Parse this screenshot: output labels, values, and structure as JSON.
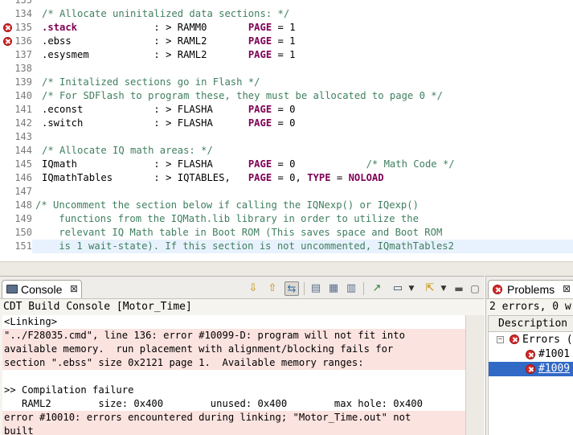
{
  "editor": {
    "lines": [
      {
        "num": "135",
        "tokens": []
      },
      {
        "num": "134",
        "tokens": [
          {
            "c": "cm",
            "t": "/* Allocate uninitalized data sections: */"
          }
        ]
      },
      {
        "num": "135",
        "error": true,
        "tokens": [
          {
            "c": "kw",
            "t": ".stack"
          },
          {
            "c": "",
            "t": "             : > RAMM0       "
          },
          {
            "c": "kw",
            "t": "PAGE"
          },
          {
            "c": "",
            "t": " = 1"
          }
        ]
      },
      {
        "num": "136",
        "error": true,
        "tokens": [
          {
            "c": "",
            "t": ".ebss              : > RAML2       "
          },
          {
            "c": "kw",
            "t": "PAGE"
          },
          {
            "c": "",
            "t": " = 1"
          }
        ]
      },
      {
        "num": "137",
        "tokens": [
          {
            "c": "",
            "t": ".esysmem           : > RAML2       "
          },
          {
            "c": "kw",
            "t": "PAGE"
          },
          {
            "c": "",
            "t": " = 1"
          }
        ]
      },
      {
        "num": "138",
        "tokens": []
      },
      {
        "num": "139",
        "tokens": [
          {
            "c": "cm",
            "t": "/* Initalized sections go in Flash */"
          }
        ]
      },
      {
        "num": "140",
        "tokens": [
          {
            "c": "cm",
            "t": "/* For SDFlash to program these, they must be allocated to page 0 */"
          }
        ]
      },
      {
        "num": "141",
        "tokens": [
          {
            "c": "",
            "t": ".econst            : > FLASHA      "
          },
          {
            "c": "kw",
            "t": "PAGE"
          },
          {
            "c": "",
            "t": " = 0"
          }
        ]
      },
      {
        "num": "142",
        "tokens": [
          {
            "c": "",
            "t": ".switch            : > FLASHA      "
          },
          {
            "c": "kw",
            "t": "PAGE"
          },
          {
            "c": "",
            "t": " = 0"
          }
        ]
      },
      {
        "num": "143",
        "tokens": []
      },
      {
        "num": "144",
        "tokens": [
          {
            "c": "cm",
            "t": "/* Allocate IQ math areas: */"
          }
        ]
      },
      {
        "num": "145",
        "tokens": [
          {
            "c": "",
            "t": "IQmath             : > FLASHA      "
          },
          {
            "c": "kw",
            "t": "PAGE"
          },
          {
            "c": "",
            "t": " = 0            "
          },
          {
            "c": "cm",
            "t": "/* Math Code */"
          }
        ]
      },
      {
        "num": "146",
        "tokens": [
          {
            "c": "",
            "t": "IQmathTables       : > IQTABLES,   "
          },
          {
            "c": "kw",
            "t": "PAGE"
          },
          {
            "c": "",
            "t": " = 0, "
          },
          {
            "c": "kw",
            "t": "TYPE"
          },
          {
            "c": "",
            "t": " = "
          },
          {
            "c": "kw",
            "t": "NOLOAD"
          }
        ]
      },
      {
        "num": "147",
        "tokens": []
      },
      {
        "num": "148",
        "tokens": [
          {
            "c": "cm",
            "t": "/* Uncomment the section below if calling the IQNexp() or IQexp()"
          }
        ],
        "indent": -1
      },
      {
        "num": "149",
        "tokens": [
          {
            "c": "cm",
            "t": "    functions from the IQMath.lib library in order to utilize the"
          }
        ],
        "indent": -1
      },
      {
        "num": "150",
        "tokens": [
          {
            "c": "cm",
            "t": "    relevant IQ Math table in Boot ROM (This saves space and Boot ROM"
          }
        ],
        "indent": -1
      },
      {
        "num": "151",
        "current": true,
        "tokens": [
          {
            "c": "cm",
            "t": "    is 1 wait-state). If this section is not uncommented, IQmathTables2"
          }
        ],
        "indent": -1
      }
    ]
  },
  "console": {
    "tab_label": "Console",
    "tab_close": "⊠",
    "title": "CDT Build Console [Motor_Time]",
    "lines": [
      {
        "text": "<Linking>",
        "error": false
      },
      {
        "text": "\"../F28035.cmd\", line 136: error #10099-D: program will not fit into",
        "error": true
      },
      {
        "text": "available memory.  run placement with alignment/blocking fails for",
        "error": true
      },
      {
        "text": "section \".ebss\" size 0x2121 page 1.  Available memory ranges:",
        "error": true
      },
      {
        "text": "",
        "error": false
      },
      {
        "text": ">> Compilation failure",
        "error": false
      },
      {
        "text": "   RAML2        size: 0x400        unused: 0x400        max hole: 0x400",
        "error": false
      },
      {
        "text": "error #10010: errors encountered during linking; \"Motor_Time.out\" not",
        "error": true
      },
      {
        "text": "built",
        "error": true
      }
    ]
  },
  "problems": {
    "tab_label": "Problems",
    "tab_close": "⊠",
    "summary": "2 errors, 0 w",
    "column_header": "Description",
    "group_label": "Errors (",
    "items": [
      "#1001",
      "#1009"
    ]
  }
}
